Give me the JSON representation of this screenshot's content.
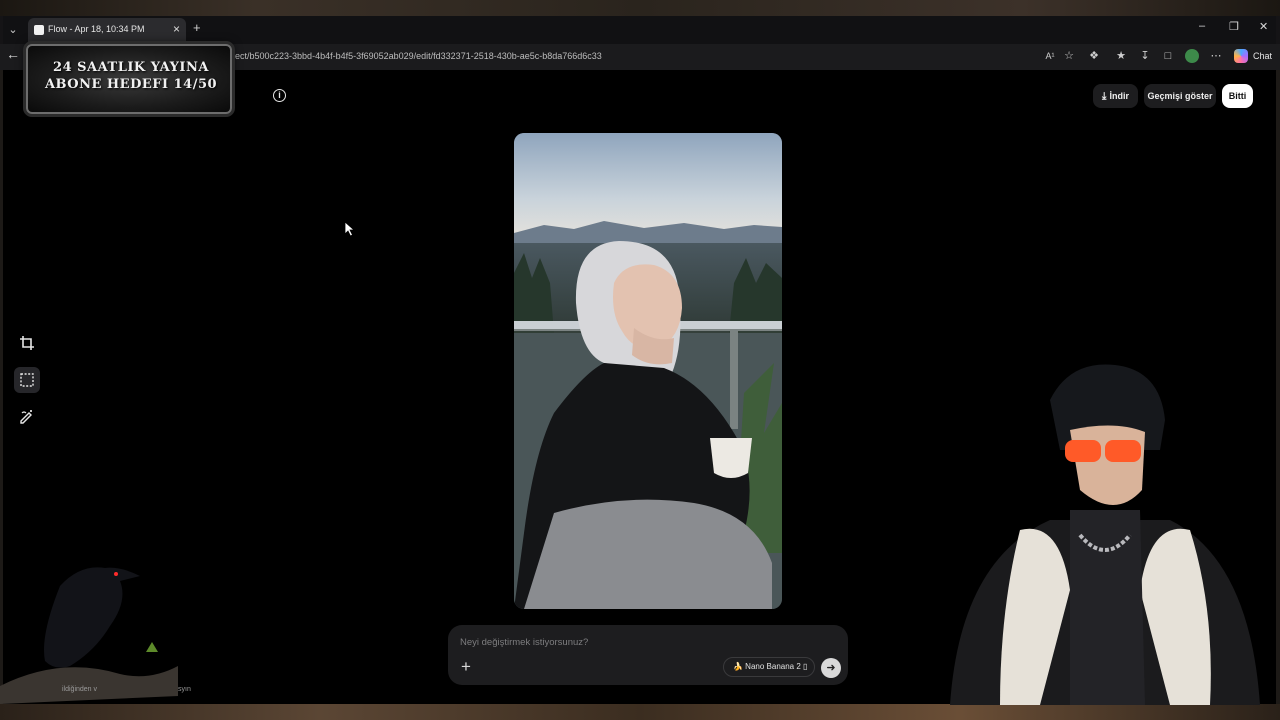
{
  "browser": {
    "tab_title": "Flow - Apr 18, 10:34 PM",
    "url": "oject/b500c223-3bbd-4b4f-b4f5-3f69052ab029/edit/fd332371-2518-430b-ae5c-b8da766d6c33",
    "chat_label": "Chat",
    "read_aloud_glyph": "A¹",
    "icons": [
      "tab-list-icon",
      "close-icon",
      "new-tab-icon",
      "minimize-icon",
      "restore-icon",
      "window-close-icon",
      "back-icon",
      "read-aloud-icon",
      "favorite-icon",
      "extensions-icon",
      "favorites-icon",
      "downloads-icon",
      "screenshot-icon",
      "profile-icon",
      "more-icon",
      "copilot-icon"
    ]
  },
  "overlay": {
    "banner_line1": "24 SAATLIK YAYINA",
    "banner_line2": "ABONE HEDEFI 14/50",
    "crow_text_left": "ildiğinden v",
    "crow_text_right": "syın"
  },
  "header": {
    "download_label": "İndir",
    "history_label": "Geçmişi göster",
    "done_label": "Bitti"
  },
  "tools": [
    "crop-icon",
    "select-area-icon",
    "draw-edit-icon"
  ],
  "prompt": {
    "placeholder": "Neyi değiştirmek istiyorsunuz?",
    "value": "",
    "model_label": "🍌 Nano Banana 2 ▯"
  },
  "colors": {
    "page_bg": "#000000",
    "panel_bg": "#1d1d1f",
    "primary_button": "#ffffff"
  }
}
